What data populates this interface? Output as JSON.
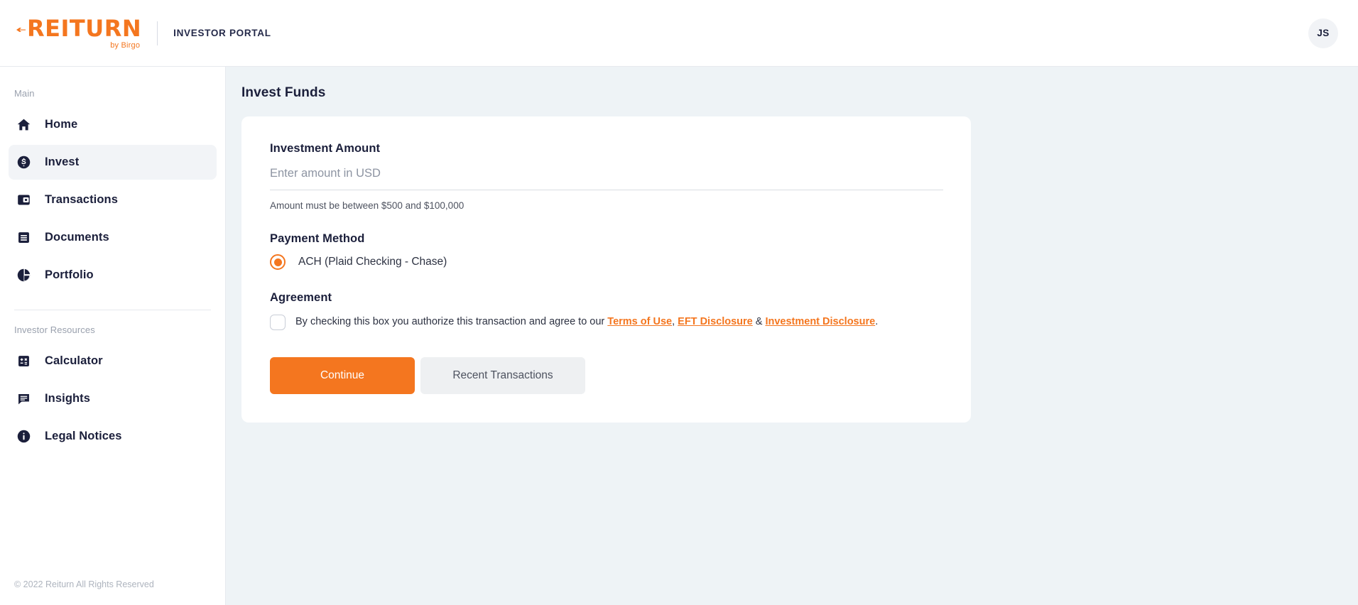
{
  "topbar": {
    "logo_text": "REITURN",
    "logo_sub": "by Birgo",
    "logo_arrow_icon": "left-arrow-icon",
    "portal_label": "INVESTOR PORTAL",
    "avatar_initials": "JS"
  },
  "sidebar": {
    "main_section_label": "Main",
    "resources_section_label": "Investor Resources",
    "main_items": [
      {
        "label": "Home",
        "icon": "home-icon",
        "active": false
      },
      {
        "label": "Invest",
        "icon": "dollar-circle-icon",
        "active": true
      },
      {
        "label": "Transactions",
        "icon": "wallet-icon",
        "active": false
      },
      {
        "label": "Documents",
        "icon": "document-icon",
        "active": false
      },
      {
        "label": "Portfolio",
        "icon": "pie-chart-icon",
        "active": false
      }
    ],
    "resource_items": [
      {
        "label": "Calculator",
        "icon": "calculator-icon",
        "active": false
      },
      {
        "label": "Insights",
        "icon": "chat-bubble-icon",
        "active": false
      },
      {
        "label": "Legal Notices",
        "icon": "info-circle-icon",
        "active": false
      }
    ],
    "footer": "© 2022 Reiturn All Rights Reserved"
  },
  "main": {
    "page_title": "Invest Funds",
    "amount": {
      "label": "Investment Amount",
      "placeholder": "Enter amount in USD",
      "value": "",
      "hint": "Amount must be between $500 and $100,000"
    },
    "payment_method": {
      "label": "Payment Method",
      "option_label": "ACH (Plaid Checking - Chase)",
      "selected": true
    },
    "agreement": {
      "label": "Agreement",
      "checked": false,
      "text_before": "By checking this box you authorize this transaction and agree to our ",
      "link_1": "Terms of Use",
      "separator_1": ", ",
      "link_2": "EFT Disclosure",
      "separator_2": " & ",
      "link_3": "Investment Disclosure",
      "text_after": "."
    },
    "buttons": {
      "primary": "Continue",
      "secondary": "Recent Transactions"
    }
  },
  "colors": {
    "brand_orange": "#f4761f",
    "navy": "#1b1f3b",
    "page_background": "#eef3f6",
    "card_background": "#ffffff",
    "active_nav_background": "#f2f4f7"
  }
}
